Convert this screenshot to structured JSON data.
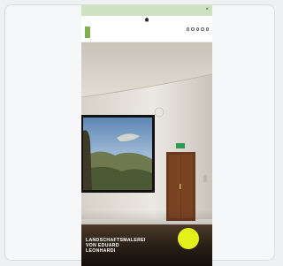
{
  "notice": {
    "text": "",
    "close_symbol": "×"
  },
  "header": {
    "logo_text": "",
    "utility_icons": [
      "search-icon",
      "user-icon",
      "cart-icon",
      "globe-icon",
      "menu-icon"
    ],
    "nav": [
      "",
      "",
      ""
    ]
  },
  "hero": {
    "title_lines": [
      "LANDSCHAFTSMALEREI",
      "VON EDUARD",
      "LEONHARDI"
    ],
    "subtitle": "",
    "badge": ""
  },
  "colors": {
    "notice_bg": "#cfe1c3",
    "brand_green": "#7fb24e",
    "badge_yellow": "#e4f01a"
  }
}
